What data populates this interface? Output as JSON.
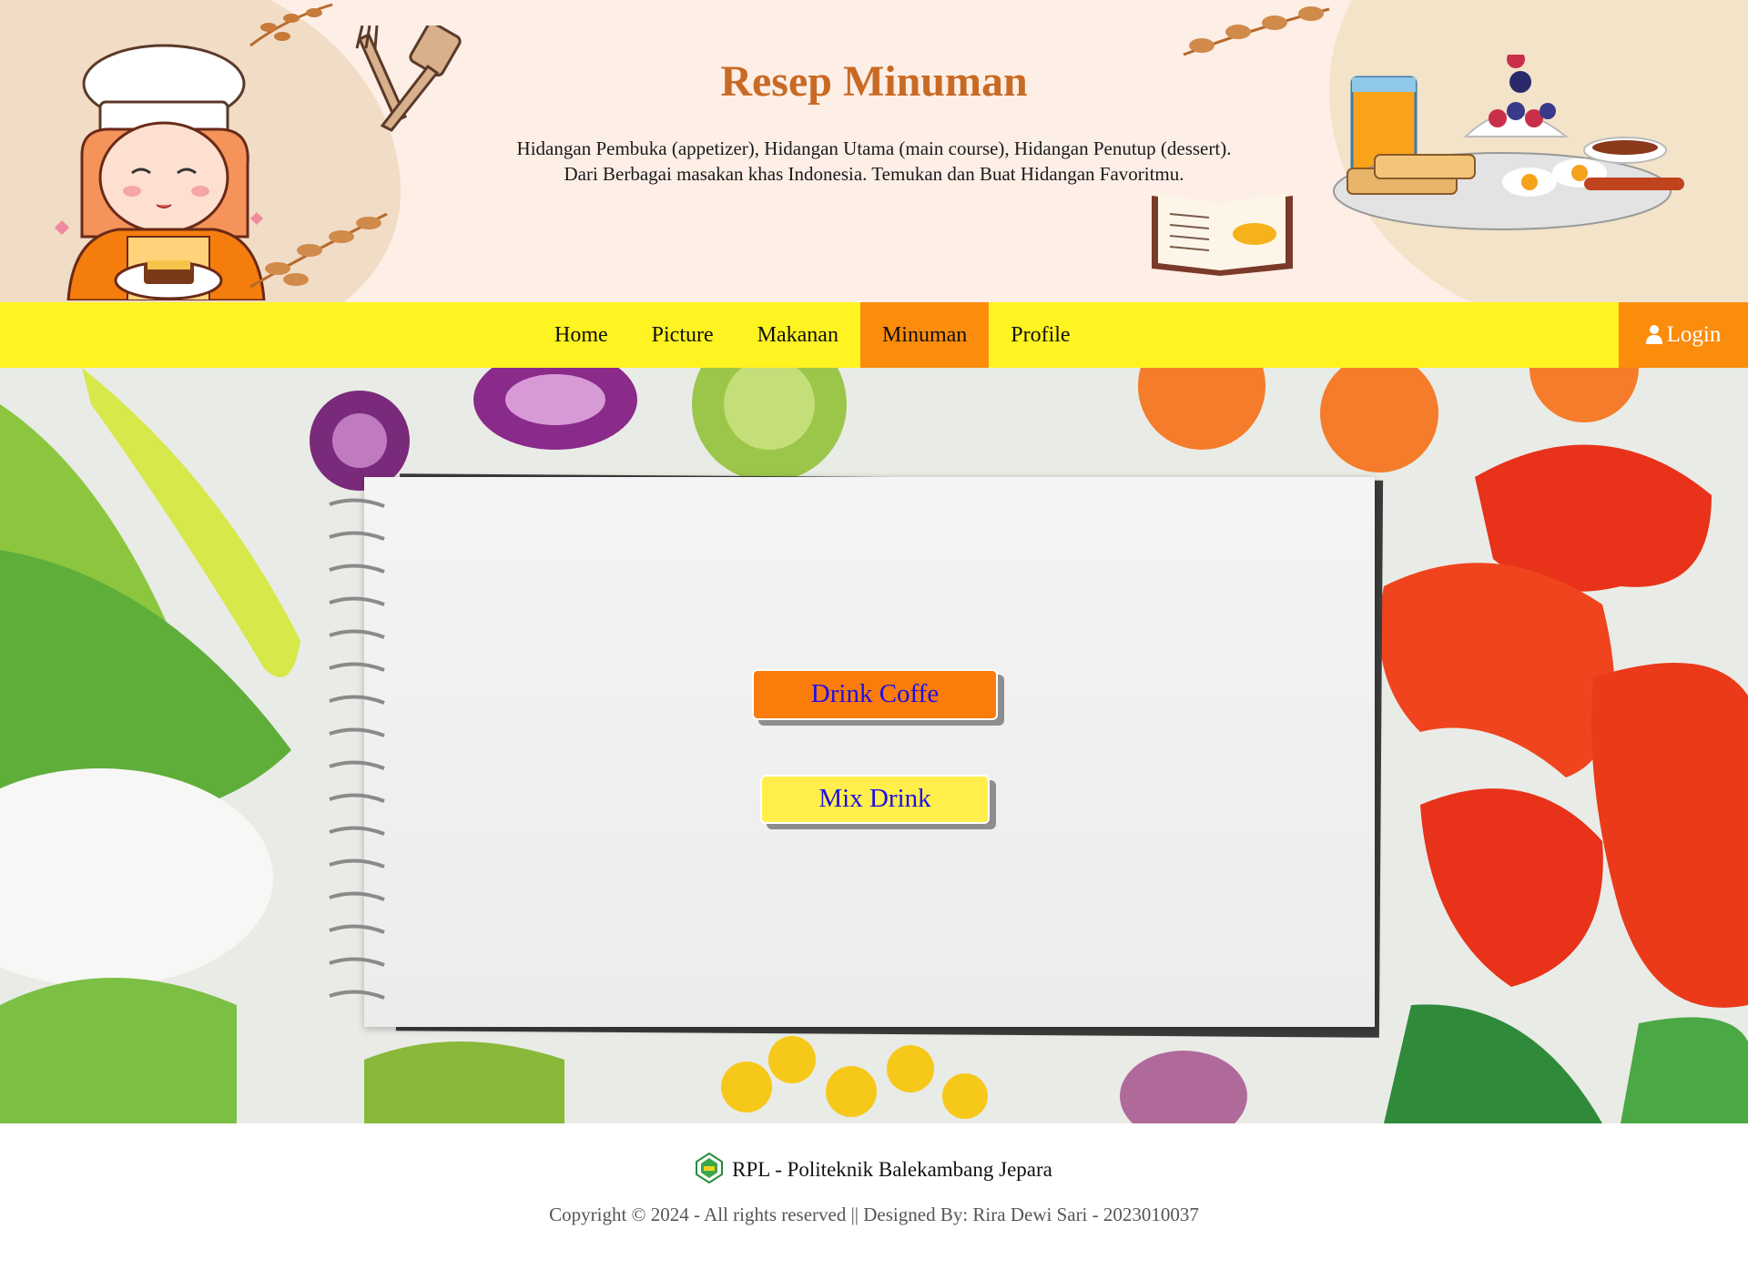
{
  "header": {
    "title": "Resep Minuman",
    "subtitle_line1": "Hidangan Pembuka (appetizer), Hidangan Utama (main course), Hidangan Penutup (dessert).",
    "subtitle_line2": "Dari Berbagai masakan khas Indonesia. Temukan dan Buat Hidangan Favoritmu."
  },
  "nav": {
    "items": [
      {
        "label": "Home"
      },
      {
        "label": "Picture"
      },
      {
        "label": "Makanan"
      },
      {
        "label": "Minuman",
        "active": true
      },
      {
        "label": "Profile"
      }
    ],
    "login_label": "Login",
    "login_icon": "user-icon"
  },
  "main": {
    "buttons": [
      {
        "label": "Drink Coffe"
      },
      {
        "label": "Mix Drink"
      }
    ]
  },
  "footer": {
    "brand": "RPL - Politeknik Balekambang Jepara",
    "copyright": "Copyright © 2024 - All rights reserved || Designed By: Rira Dewi Sari - 2023010037"
  },
  "colors": {
    "nav_bg": "#fff321",
    "accent_orange": "#fb8c0c",
    "title": "#c96a24",
    "button_yellow": "#ffee4c",
    "button_text": "#1c0fe6"
  }
}
